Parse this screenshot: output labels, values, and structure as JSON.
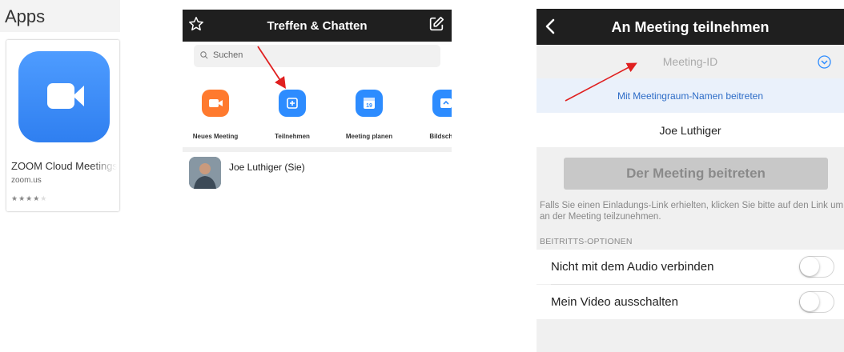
{
  "app_store": {
    "title": "Apps",
    "app_name": "ZOOM Cloud Meetings",
    "vendor": "zoom.us",
    "rating_stars": 4,
    "icon": "zoom-camera-icon",
    "icon_color": "#2d8cff"
  },
  "meet_chat": {
    "title": "Treffen & Chatten",
    "search_placeholder": "Suchen",
    "actions": [
      {
        "label": "Neues Meeting",
        "icon": "video-camera-icon",
        "color": "#ff7a2e"
      },
      {
        "label": "Teilnehmen",
        "icon": "plus-icon",
        "color": "#2d8cff"
      },
      {
        "label": "Meeting planen",
        "icon": "calendar-icon",
        "color": "#2d8cff",
        "date": "19"
      },
      {
        "label": "Bildschirm",
        "icon": "share-screen-icon",
        "color": "#2d8cff"
      }
    ],
    "contact": "Joe Luthiger (Sie)"
  },
  "join": {
    "title": "An Meeting teilnehmen",
    "meeting_id_placeholder": "Meeting-ID",
    "room_name_link": "Mit Meetingraum-Namen beitreten",
    "display_name": "Joe Luthiger",
    "join_button": "Der Meeting beitreten",
    "hint": "Falls Sie einen Einladungs-Link erhielten, klicken Sie bitte auf den Link um an der Meeting teilzunehmen.",
    "section_label": "BEITRITTS-OPTIONEN",
    "options": [
      {
        "label": "Nicht mit dem Audio verbinden",
        "on": false
      },
      {
        "label": "Mein Video ausschalten",
        "on": false
      }
    ]
  },
  "colors": {
    "dark_bar": "#1f1f1f",
    "link_blue": "#2d6cc7",
    "arrow_red": "#e02020"
  }
}
